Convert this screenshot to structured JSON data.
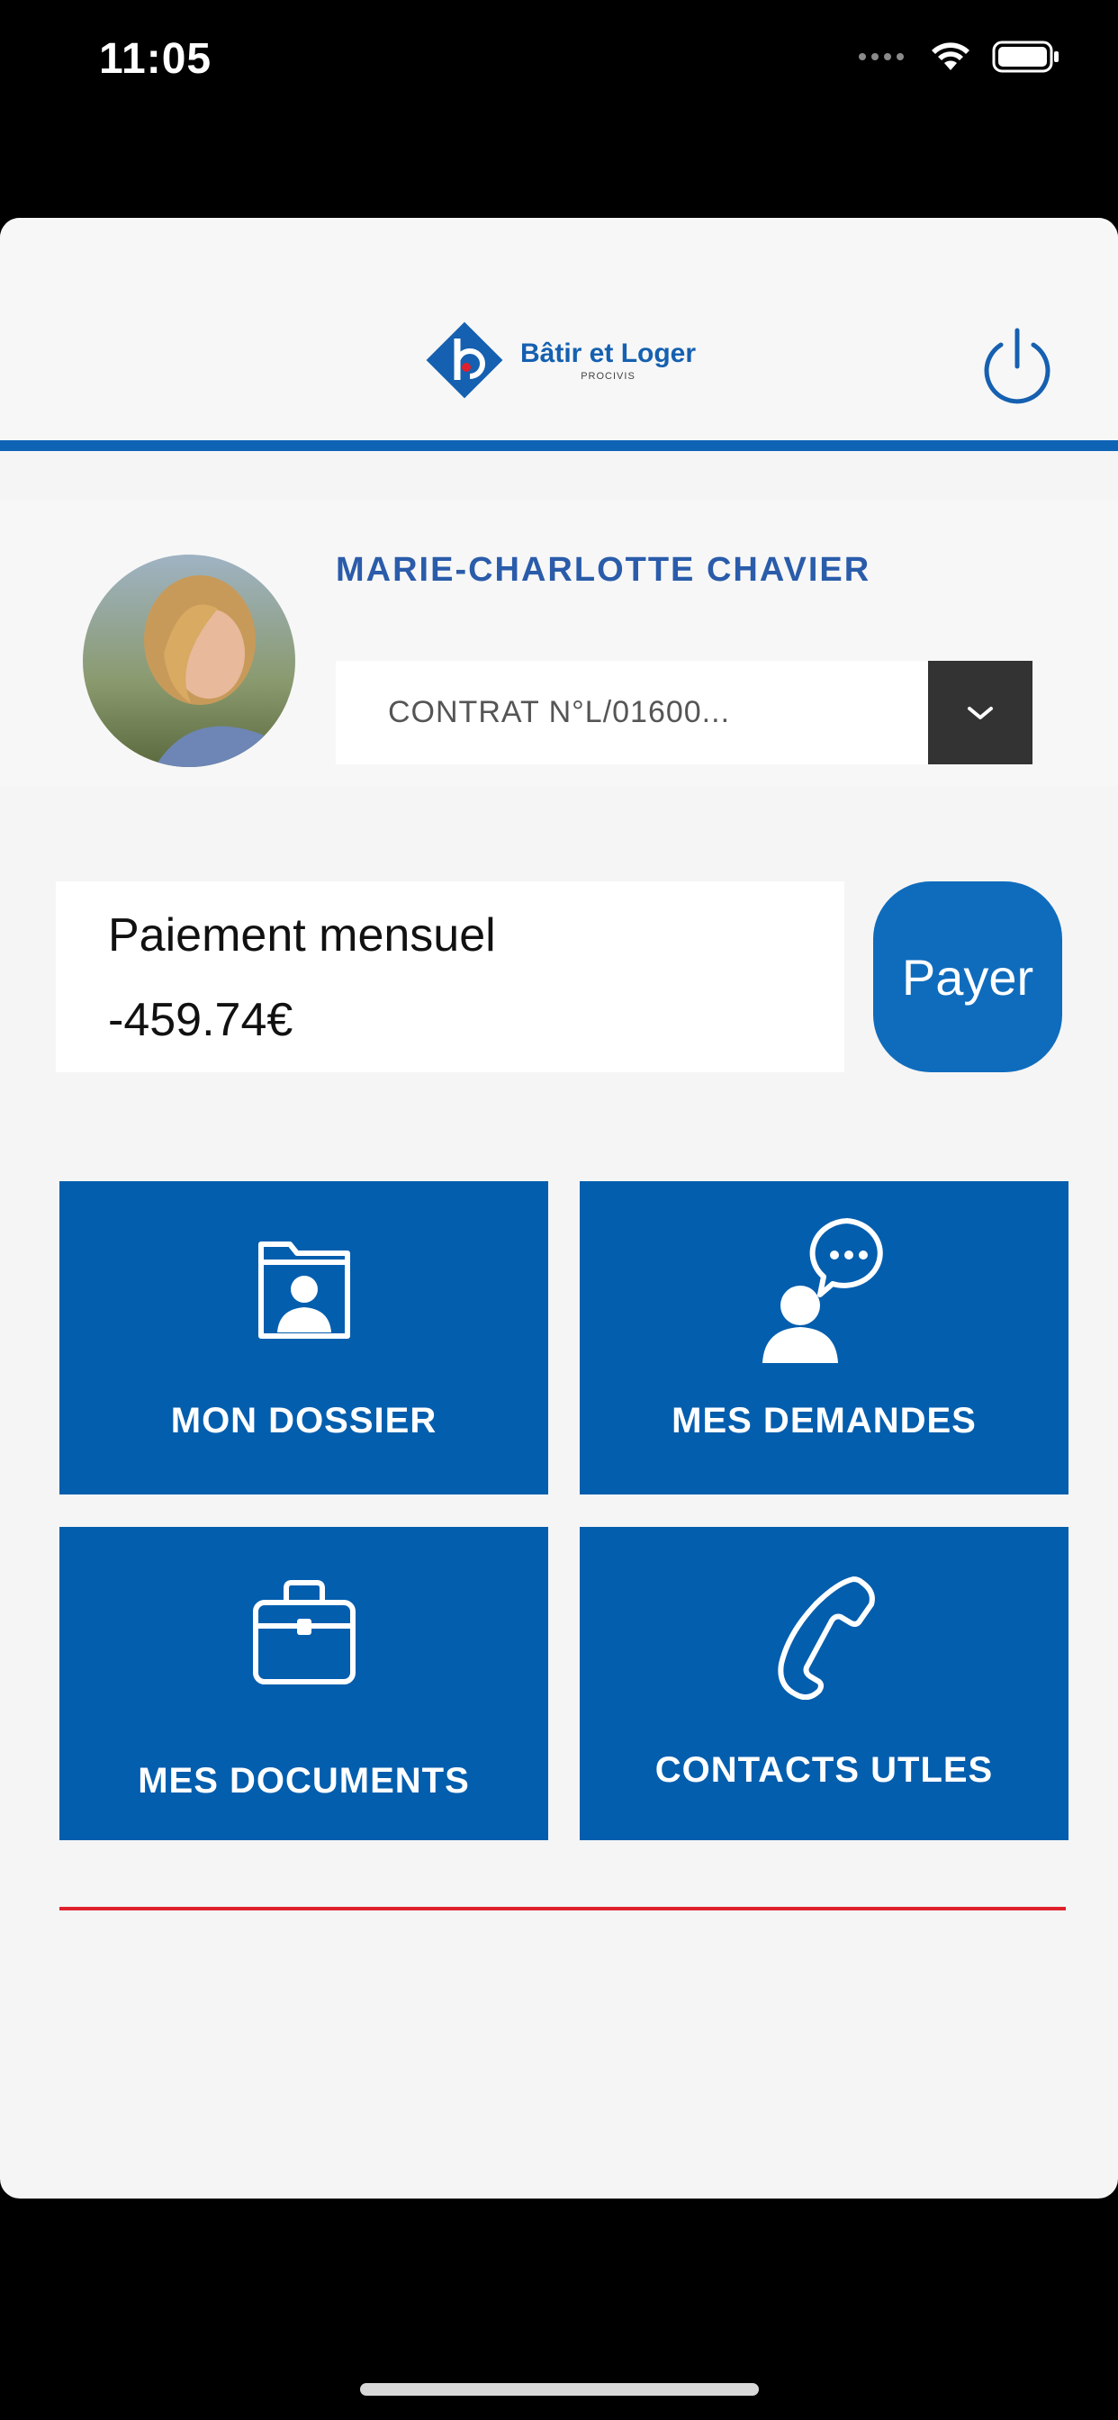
{
  "status_bar": {
    "time": "11:05"
  },
  "header": {
    "logo_title": "Bâtir et Loger",
    "logo_subtitle": "PROCIVIS"
  },
  "profile": {
    "name": "MARIE-CHARLOTTE CHAVIER",
    "contract": "CONTRAT N°L/01600..."
  },
  "payment": {
    "label": "Paiement mensuel",
    "amount": "-459.74€",
    "pay_button": "Payer"
  },
  "tiles": [
    {
      "label": "MON DOSSIER",
      "icon": "folder-user-icon"
    },
    {
      "label": "MES DEMANDES",
      "icon": "user-chat-icon"
    },
    {
      "label": "MES DOCUMENTS",
      "icon": "briefcase-icon"
    },
    {
      "label": "CONTACTS UTLES",
      "icon": "phone-icon"
    }
  ],
  "colors": {
    "primary_blue": "#035eae",
    "accent_blue": "#0f63b5",
    "divider_red": "#e0202c"
  }
}
